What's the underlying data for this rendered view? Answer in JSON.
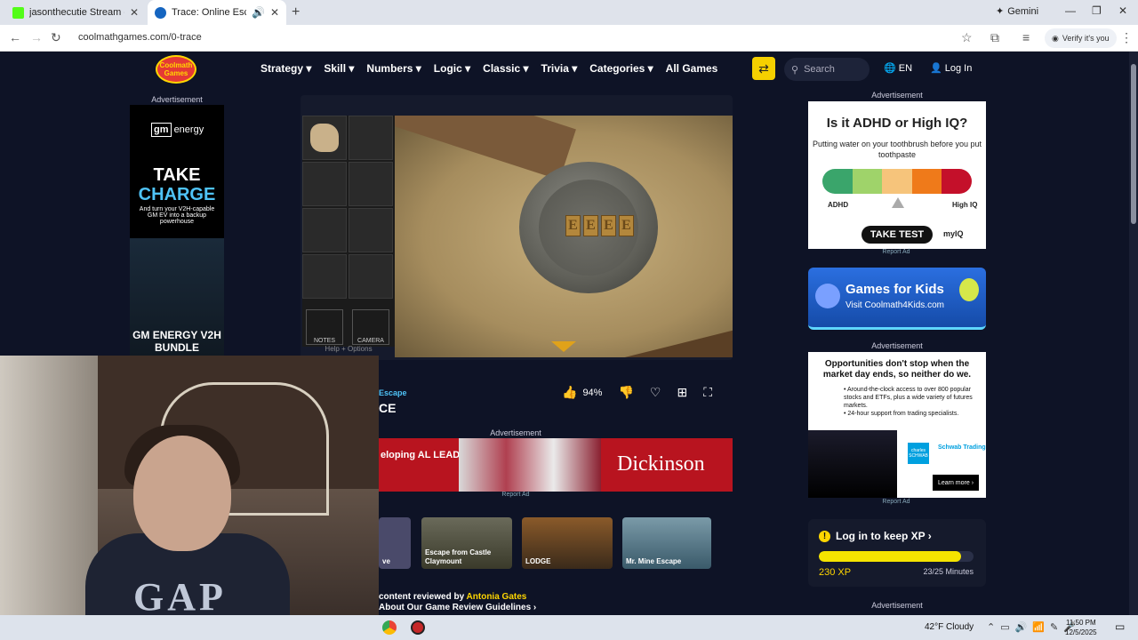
{
  "browser": {
    "tabs": [
      {
        "title": "jasonthecutie Stream - Watch L",
        "active": false
      },
      {
        "title": "Trace: Online Escape Room",
        "active": true
      }
    ],
    "gemini_label": "Gemini",
    "url": "coolmathgames.com/0-trace",
    "verify_label": "Verify it's you"
  },
  "site": {
    "logo": "Coolmath Games",
    "menu": [
      "Strategy ▾",
      "Skill ▾",
      "Numbers ▾",
      "Logic ▾",
      "Classic ▾",
      "Trivia ▾",
      "Categories ▾",
      "All Games"
    ],
    "search_placeholder": "Search",
    "lang": "EN",
    "login": "Log In"
  },
  "ads": {
    "label": "Advertisement",
    "report": "Report Ad",
    "left": {
      "brand": "energy",
      "take": "TAKE",
      "charge": "CHARGE",
      "sub": "And turn your V2H-capable GM EV into a backup powerhouse",
      "bottom": "GM ENERGY V2H BUNDLE"
    },
    "mid": {
      "left_text": "eloping AL LEADERS",
      "brand": "Dickinson"
    },
    "adhd": {
      "question": "Is it ADHD or High IQ?",
      "sub": "Putting water on your toothbrush before you put toothpaste",
      "left": "ADHD",
      "right": "High IQ",
      "button": "TAKE TEST",
      "brand": "myIQ",
      "scale_colors": [
        "#3aa56b",
        "#9fd36a",
        "#f6c47b",
        "#ef7a1a",
        "#c4102a"
      ]
    },
    "kids": {
      "title": "Games for Kids",
      "url": "Visit Coolmath4Kids.com"
    },
    "schwab": {
      "headline": "Opportunities don't stop when the market day ends, so neither do we.",
      "bullets": "• Around-the-clock access to over 800 popular stocks and ETFs, plus a wide variety of futures markets.\n• 24-hour support from trading specialists.",
      "logo": "charles SCHWAB",
      "sub_brand": "Schwab Trading",
      "cta": "Learn more ›"
    }
  },
  "game": {
    "inventory_tools": [
      "NOTES",
      "CAMERA"
    ],
    "help": "Help + Options",
    "seal_letters": [
      "E",
      "E",
      "E",
      "E"
    ],
    "category": "Escape",
    "title": "CE",
    "rating": "94%"
  },
  "related": [
    {
      "label": "ve"
    },
    {
      "label": "Escape from Castle Claymount"
    },
    {
      "label": "LODGE"
    },
    {
      "label": "Mr. Mine Escape"
    }
  ],
  "review": {
    "prefix": "content reviewed by ",
    "name": "Antonia Gates",
    "link": "About Our Game Review Guidelines ›"
  },
  "xp": {
    "prompt": "Log in to keep XP ›",
    "value": "230 XP",
    "minutes": "23/25 Minutes",
    "progress": 0.92
  },
  "cam": {
    "shirt_text": "GAP"
  },
  "taskbar": {
    "weather": "42°F  Cloudy",
    "time": "11:50 PM",
    "date": "12/5/2025"
  }
}
